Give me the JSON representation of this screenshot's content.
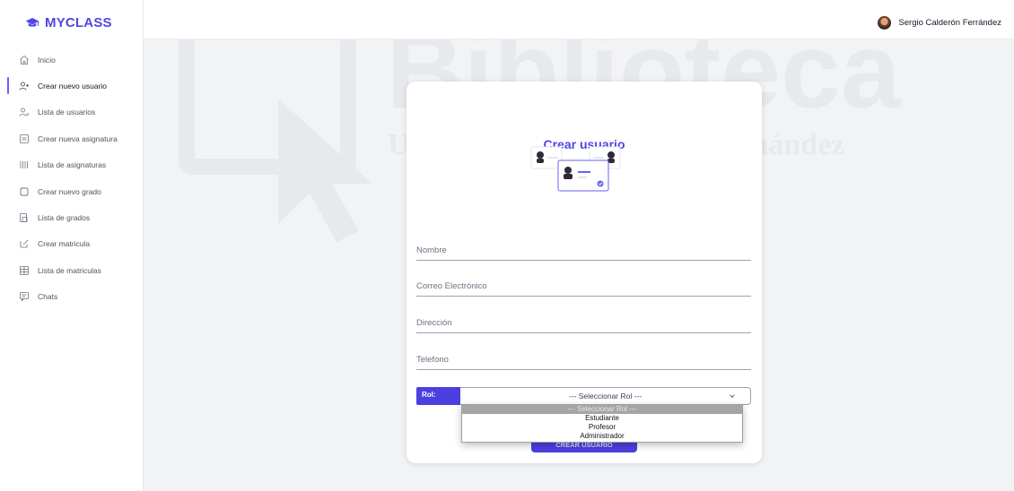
{
  "brand": {
    "name": "MYCLASS",
    "icon": "graduation-cap-icon"
  },
  "user": {
    "name": "Sergio Calderón Ferrández"
  },
  "nav": {
    "items": [
      {
        "label": "Inicio",
        "icon": "home-icon"
      },
      {
        "label": "Crear nuevo usuario",
        "icon": "user-plus-icon",
        "active": true
      },
      {
        "label": "Lista de usuarios",
        "icon": "users-icon"
      },
      {
        "label": "Crear nueva asignatura",
        "icon": "square-plus-icon"
      },
      {
        "label": "Lista de asignaturas",
        "icon": "grid-icon"
      },
      {
        "label": "Crear nuevo grado",
        "icon": "square-icon"
      },
      {
        "label": "Lista de grados",
        "icon": "copy-icon"
      },
      {
        "label": "Crear matricula",
        "icon": "edit-icon"
      },
      {
        "label": "Lista de matriculas",
        "icon": "table-icon"
      },
      {
        "label": "Chats",
        "icon": "chat-icon"
      }
    ]
  },
  "watermark": {
    "line1": "Biblioteca",
    "line2": "UNIVERSITAS Miguel Hernández"
  },
  "form": {
    "title": "Crear usuario",
    "fields": {
      "nombre": {
        "placeholder": "Nombre"
      },
      "correo": {
        "placeholder": "Correo Electrónico"
      },
      "direccion": {
        "placeholder": "Dirección"
      },
      "telefono": {
        "placeholder": "Telefono"
      }
    },
    "rol_label": "Rol:",
    "rol_selected": "--- Seleccionar Rol ---",
    "rol_options": [
      "--- Seleccionar Rol ---",
      "Estudiante",
      "Profesor",
      "Administrador"
    ],
    "submit_label": "CREAR USUARIO"
  },
  "colors": {
    "accent": "#4f46e5",
    "button": "#4c3fe0",
    "background": "#f2f3f5"
  }
}
